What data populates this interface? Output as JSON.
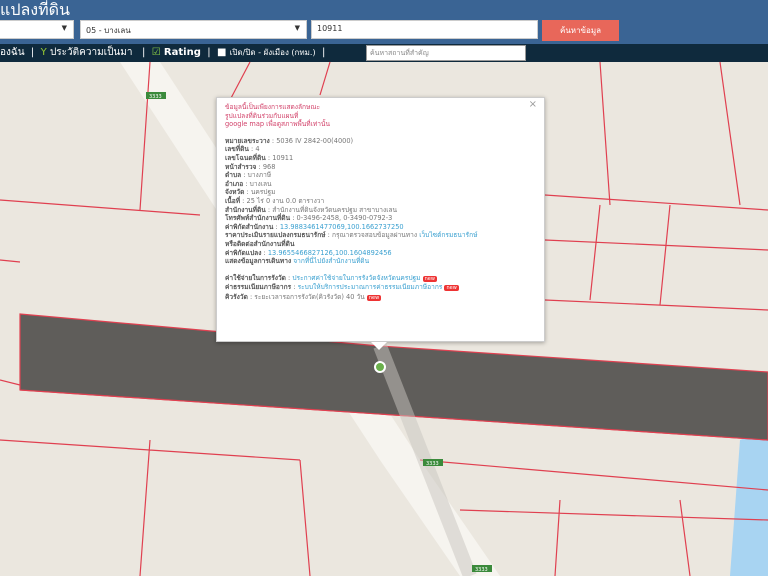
{
  "header": {
    "title": "แปลงที่ดิน",
    "province_select": "",
    "district_select": "05 - บางเลน",
    "parcel_input": "10911",
    "search_button": "ค้นหาข้อมูล"
  },
  "toolbar": {
    "item1": "องฉัน",
    "item2": "ประวัติความเป็นมา",
    "item3": "Rating",
    "item4": "เปิด/ปิด - ผังเมือง (กทม.)",
    "search_placeholder": "ค้นหาสถานที่สำคัญ"
  },
  "popup": {
    "disclaimer": [
      "ข้อมูลนี้เป็นเพียงการแสดงลักษณะ",
      "รูปแปลงที่ดินร่วมกับแผนที่",
      "google map เพื่อดูสภาพพื้นที่เท่านั้น"
    ],
    "fields": [
      {
        "label": "หมายเลขระวาง",
        "value": "5036 IV 2842-00(4000)"
      },
      {
        "label": "เลขที่ดิน",
        "value": "4"
      },
      {
        "label": "เลขโฉนดที่ดิน",
        "value": "10911"
      },
      {
        "label": "หน้าสำรวจ",
        "value": "968"
      },
      {
        "label": "ตำบล",
        "value": "บางภาษี"
      },
      {
        "label": "อำเภอ",
        "value": "บางเลน"
      },
      {
        "label": "จังหวัด",
        "value": "นครปฐม"
      },
      {
        "label": "เนื้อที่",
        "value": "25 ไร่ 0 งาน 0.0 ตารางวา"
      },
      {
        "label": "สำนักงานที่ดิน",
        "value": "สำนักงานที่ดินจังหวัดนครปฐม สาขาบางเลน"
      },
      {
        "label": "โทรศัพท์สำนักงานที่ดิน",
        "value": "0-3496-2458, 0-3490-0792-3"
      },
      {
        "label": "ค่าพิกัดสำนักงาน",
        "value": "13.9883461477069,100.1662737250",
        "link": true
      },
      {
        "label": "ราคาประเมินรายแปลงกรมธนารักษ์",
        "value": "กรุณาตรวจสอบข้อมูลผ่านทาง",
        "link_text": "เว็บไซต์กรมธนารักษ์"
      },
      {
        "label": "หรือติดต่อสำนักงานที่ดิน",
        "value": ""
      },
      {
        "label": "ค่าพิกัดแปลง",
        "value": "13.9655466827126,100.1604892456",
        "link": true
      },
      {
        "label": "แสดงข้อมูลการเดินทาง",
        "value": "",
        "link_text": "จากที่นี่ไปยังสำนักงานที่ดิน"
      }
    ],
    "extra": [
      {
        "label": "ค่าใช้จ่ายในการรังวัด",
        "link_text": "ประกาศค่าใช้จ่ายในการรังวัดจังหวัดนครปฐม",
        "badge": "new"
      },
      {
        "label": "ค่าธรรมเนียมภาษีอากร",
        "link_text": "ระบบให้บริการประมาณการค่าธรรมเนียมภาษีอากร",
        "badge": "new"
      },
      {
        "label": "คิวรังวัด",
        "value": "ระยะเวลารอการรังวัด(คิวรังวัด) 40 วัน",
        "badge": "new"
      }
    ],
    "close": "×"
  },
  "map": {
    "road_labels": [
      "3333",
      "3333",
      "3333"
    ],
    "parcel_color": "#5f5d5a",
    "boundary_color": "#e04050"
  }
}
